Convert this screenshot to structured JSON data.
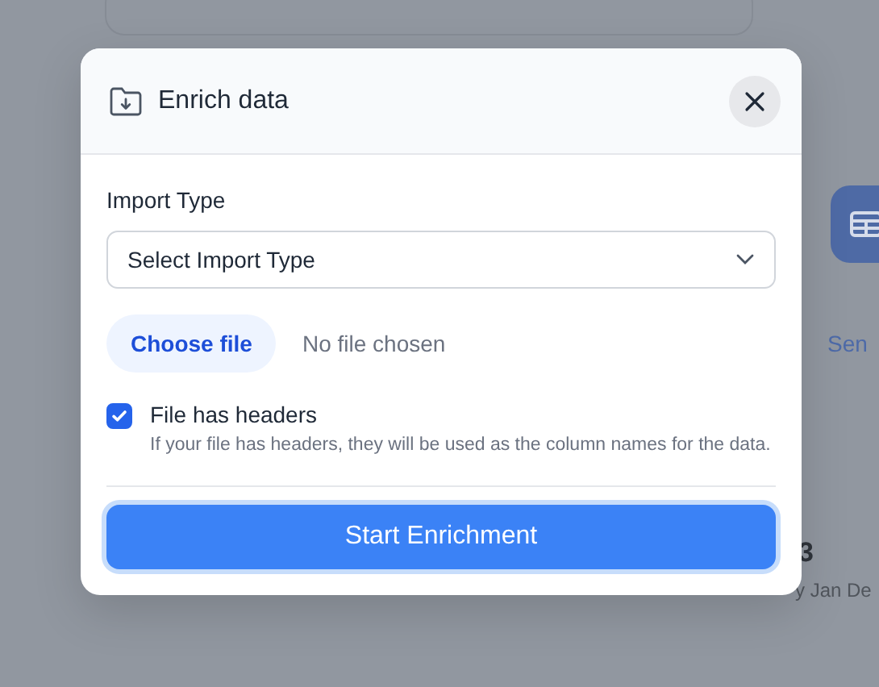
{
  "background": {
    "tab_label": "Sen",
    "row_count": "3",
    "row_text": "y Jan De"
  },
  "dialog": {
    "title": "Enrich data",
    "import_type": {
      "label": "Import Type",
      "placeholder": "Select Import Type"
    },
    "file": {
      "button": "Choose file",
      "status": "No file chosen"
    },
    "headers": {
      "label": "File has headers",
      "checked": true,
      "hint": "If your file has headers, they will be used as the column names for the data."
    },
    "submit": "Start Enrichment"
  }
}
